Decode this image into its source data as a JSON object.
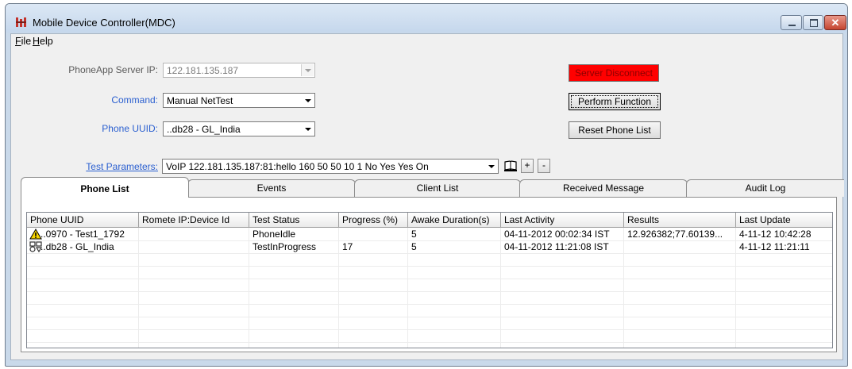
{
  "window": {
    "title": "Mobile Device Controller(MDC)"
  },
  "menu": {
    "items": [
      {
        "label_ul": "F",
        "label_rest": "ile"
      },
      {
        "label_ul": "H",
        "label_rest": "elp"
      }
    ]
  },
  "form": {
    "server_ip_label": "PhoneApp Server IP:",
    "server_ip_value": "122.181.135.187",
    "command_label": "Command:",
    "command_value": "Manual NetTest",
    "uuid_label": "Phone UUID:",
    "uuid_value": "..db28 - GL_India",
    "params_label": "Test Parameters:",
    "params_value": "VoIP 122.181.135.187:81:hello 160 50 50 10 1 No Yes Yes On",
    "book_icon": "book-icon",
    "plus_label": "+",
    "minus_label": "-"
  },
  "buttons": {
    "server_disconnect": "Server Disconnect",
    "perform_function": "Perform Function",
    "reset_phone_list": "Reset Phone List"
  },
  "colors": {
    "disconnect_bg": "#ff0000",
    "label_blue": "#2a5fd0",
    "window_frame": "#c9d9ea"
  },
  "tabs": [
    {
      "label": "Phone List",
      "active": true
    },
    {
      "label": "Events"
    },
    {
      "label": "Client List"
    },
    {
      "label": "Received Message"
    },
    {
      "label": "Audit Log"
    }
  ],
  "table": {
    "columns": [
      "Phone UUID",
      "Romete IP:Device Id",
      "Test Status",
      "Progress (%)",
      "Awake Duration(s)",
      "Last Activity",
      "Results",
      "Last Update"
    ],
    "rows": [
      {
        "icon": "warning-icon",
        "uuid": "..0970 - Test1_1792",
        "ip": "",
        "status": "PhoneIdle",
        "progress": "",
        "awake": "5",
        "activity": "04-11-2012 00:02:34 IST",
        "results": "12.926382;77.60139...",
        "update": "4-11-12 10:42:28"
      },
      {
        "icon": "busy-icon",
        "uuid": "..db28 - GL_India",
        "ip": "",
        "status": "TestInProgress",
        "progress": "17",
        "awake": "5",
        "activity": "04-11-2012 11:21:08 IST",
        "results": "",
        "update": "4-11-12 11:21:11"
      }
    ]
  }
}
